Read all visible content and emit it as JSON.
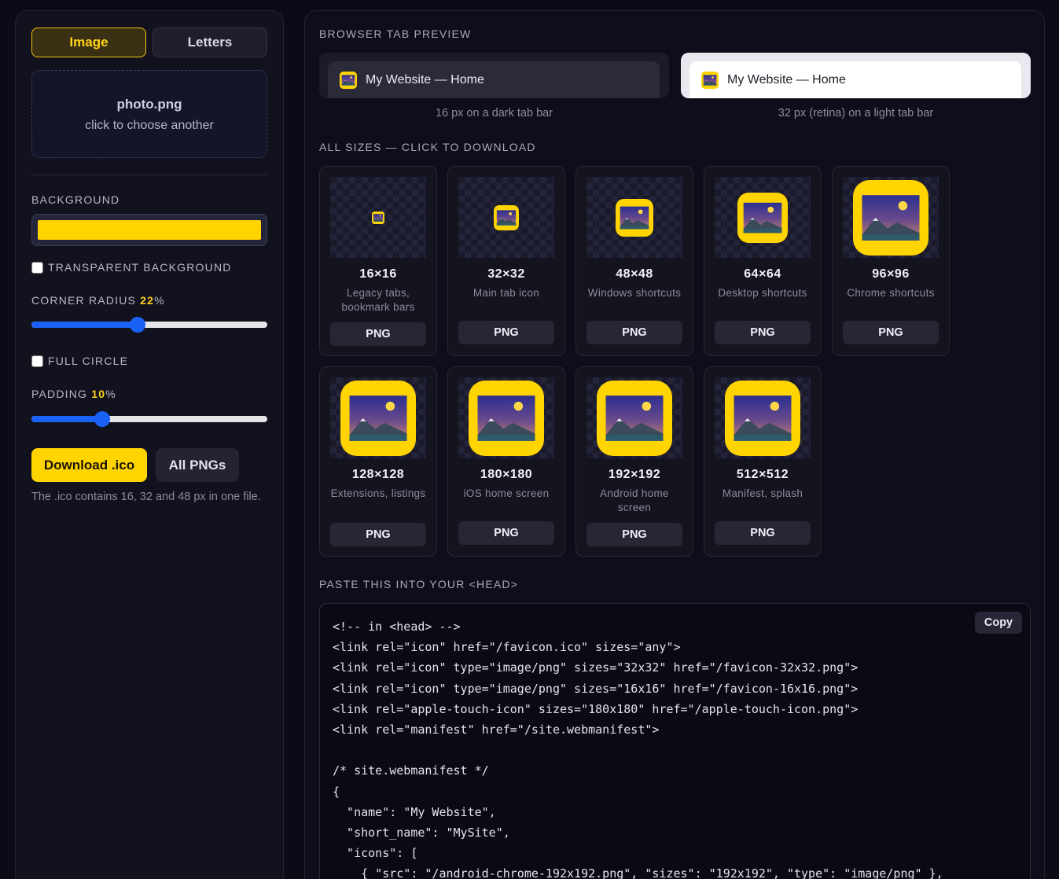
{
  "sidebar": {
    "mode_tabs": {
      "image": "Image",
      "letters": "Letters"
    },
    "dropzone": {
      "filename": "photo.png",
      "hint": "click to choose another"
    },
    "background": {
      "label": "BACKGROUND",
      "color": "#ffd400"
    },
    "transparent": {
      "label": "TRANSPARENT BACKGROUND",
      "checked": false
    },
    "corner_radius": {
      "label": "CORNER RADIUS",
      "value": "22",
      "unit": "%",
      "level": 0.45
    },
    "full_circle": {
      "label": "FULL CIRCLE",
      "checked": false
    },
    "padding": {
      "label": "PADDING",
      "value": "10",
      "unit": "%",
      "level": 0.3
    },
    "download_ico": "Download .ico",
    "all_pngs": "All PNGs",
    "note": "The .ico contains 16, 32 and 48 px in one file."
  },
  "preview": {
    "section_label": "BROWSER TAB PREVIEW",
    "tab_title": "My Website — Home",
    "dark_caption": "16 px on a dark tab bar",
    "light_caption": "32 px (retina) on a light tab bar"
  },
  "sizes": {
    "section_label": "ALL SIZES — CLICK TO DOWNLOAD",
    "button_label": "PNG",
    "items": [
      {
        "size": "16×16",
        "use": "Legacy tabs, bookmark bars"
      },
      {
        "size": "32×32",
        "use": "Main tab icon"
      },
      {
        "size": "48×48",
        "use": "Windows shortcuts"
      },
      {
        "size": "64×64",
        "use": "Desktop shortcuts"
      },
      {
        "size": "96×96",
        "use": "Chrome shortcuts"
      },
      {
        "size": "128×128",
        "use": "Extensions, listings"
      },
      {
        "size": "180×180",
        "use": "iOS home screen"
      },
      {
        "size": "192×192",
        "use": "Android home screen"
      },
      {
        "size": "512×512",
        "use": "Manifest, splash"
      }
    ]
  },
  "code": {
    "section_label": "PASTE THIS INTO YOUR <HEAD>",
    "copy_label": "Copy",
    "text": "<!-- in <head> -->\n<link rel=\"icon\" href=\"/favicon.ico\" sizes=\"any\">\n<link rel=\"icon\" type=\"image/png\" sizes=\"32x32\" href=\"/favicon-32x32.png\">\n<link rel=\"icon\" type=\"image/png\" sizes=\"16x16\" href=\"/favicon-16x16.png\">\n<link rel=\"apple-touch-icon\" sizes=\"180x180\" href=\"/apple-touch-icon.png\">\n<link rel=\"manifest\" href=\"/site.webmanifest\">\n\n/* site.webmanifest */\n{\n  \"name\": \"My Website\",\n  \"short_name\": \"MySite\",\n  \"icons\": [\n    { \"src\": \"/android-chrome-192x192.png\", \"sizes\": \"192x192\", \"type\": \"image/png\" },"
  },
  "colors": {
    "accent": "#ffd400",
    "slider": "#1a62f5"
  },
  "icons": {
    "favicon": "favicon-landscape-icon"
  }
}
